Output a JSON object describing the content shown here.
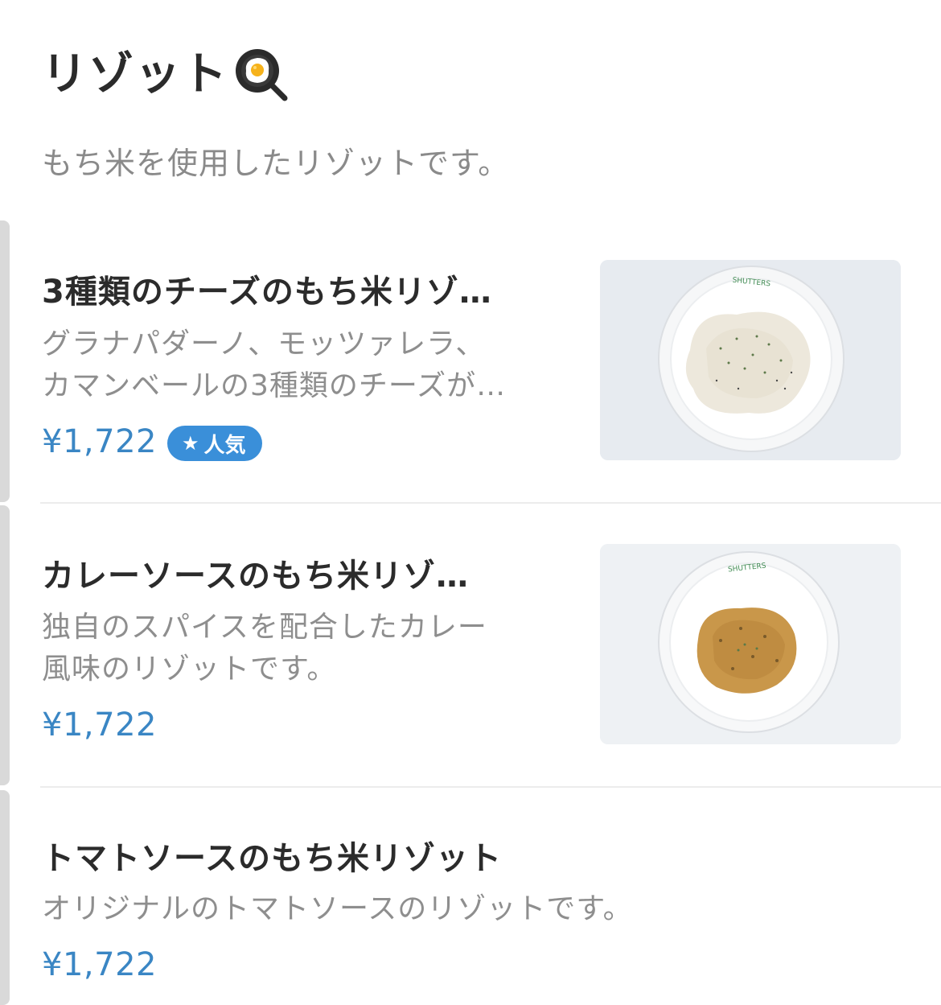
{
  "section": {
    "title": "リゾット",
    "title_icon": "frying-pan-egg-icon",
    "description": "もち米を使用したリゾットです。"
  },
  "items": [
    {
      "name": "3種類のチーズのもち米リゾ…",
      "desc_line1": "グラナパダーノ、モッツァレラ、",
      "desc_line2": "カマンベールの3種類のチーズが…",
      "price": "¥1,722",
      "badge": "人気",
      "badge_icon": "star-icon",
      "plate_text": "SHUTTERS"
    },
    {
      "name": "カレーソースのもち米リゾ…",
      "desc_line1": "独自のスパイスを配合したカレー",
      "desc_line2": "風味のリゾットです。",
      "price": "¥1,722",
      "plate_text": "SHUTTERS"
    },
    {
      "name": "トマトソースのもち米リゾット",
      "desc_line1": "オリジナルのトマトソースのリゾットです。",
      "price": "¥1,722"
    }
  ],
  "colors": {
    "price": "#3a86c4",
    "badge": "#3a8fd9",
    "muted_text": "#8e8e8e",
    "title_text": "#2b2b2b"
  }
}
